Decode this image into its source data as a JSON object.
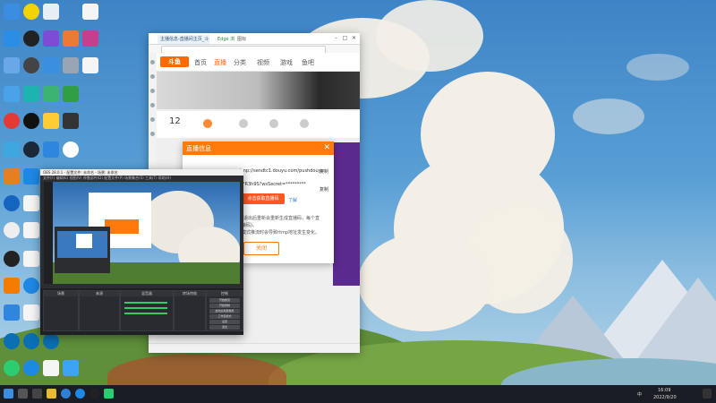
{
  "browser": {
    "tab_title": "主播信息-直播间主页_斗鱼直播",
    "tab2_title": "Edge 浏览器",
    "tab3_title": "图标",
    "controls": {
      "min": "–",
      "max": "□",
      "close": "✕"
    },
    "site": {
      "logo": "斗鱼",
      "nav": [
        "首页",
        "直播",
        "分类",
        "视频",
        "游戏",
        "鱼吧"
      ],
      "stat_number": "12"
    }
  },
  "dialog": {
    "title": "直播信息",
    "close": "✕",
    "rtmp_line": "rtmp://sendtc1.douyu.com/pushdouyu",
    "copy1": "复制",
    "key_line": "t?FR3h9S?wsSecret=*********",
    "copy2": "复制",
    "button": "点击获取直播码",
    "link": "了解",
    "note1": "(退出后重新会重新生成直播码，每个直",
    "note2": "接码)。",
    "note3": "模式推流时会导致rtmp地址发生变化。",
    "close_button": "关闭"
  },
  "obs": {
    "title": "OBS 28.0.1 - 配置文件: 未命名 - 场景: 未命名",
    "menu": "文件(F)  编辑(E)  视图(V)  停靠部件(D)  配置文件(P)  场景集合(S)  工具(T)  帮助(H)",
    "docks": [
      "场景",
      "来源",
      "混音器",
      "转场特效",
      "控制"
    ],
    "controls": [
      "开始推流",
      "开始录制",
      "启动虚拟摄像机",
      "工作室模式",
      "设置",
      "退出"
    ]
  },
  "taskbar": {
    "time": "16:09",
    "date": "2022/9/20",
    "lang": "中"
  },
  "colors": {
    "accent": "#ff7a0a",
    "douyu_orange": "#ff6a00",
    "obs_bg": "#2b2d31",
    "taskbar": "#1b1d24"
  }
}
